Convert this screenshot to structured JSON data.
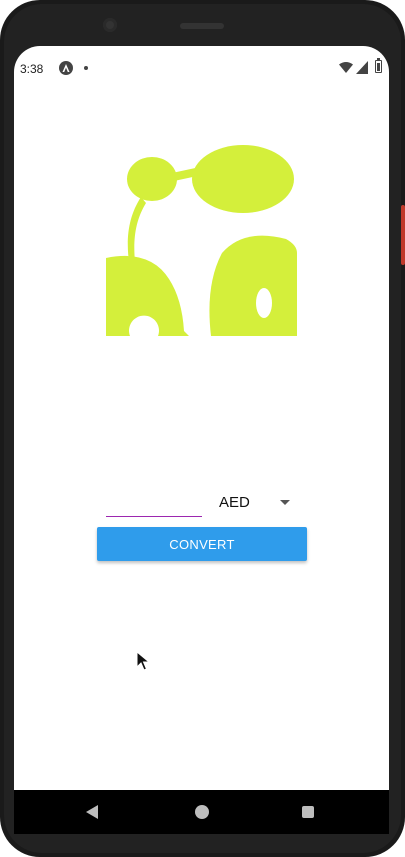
{
  "status_bar": {
    "time": "3:38",
    "app_icon": "react-native-icon",
    "notification_icon": "dot-icon",
    "wifi_icon": "wifi-icon",
    "signal_icon": "cell-signal-icon",
    "battery_icon": "battery-icon"
  },
  "logo": {
    "icon": "app-logo",
    "color": "#d4ef3b"
  },
  "converter": {
    "amount": {
      "value": "",
      "placeholder": ""
    },
    "currency": {
      "selected": "AED",
      "icon": "dropdown-arrow-icon"
    },
    "convert_label": "CONVERT",
    "accent_color": "#2f9ceb",
    "input_underline_color": "#9c27b0"
  },
  "nav_bar": {
    "back_icon": "back-triangle-icon",
    "home_icon": "home-circle-icon",
    "recents_icon": "recents-square-icon"
  }
}
